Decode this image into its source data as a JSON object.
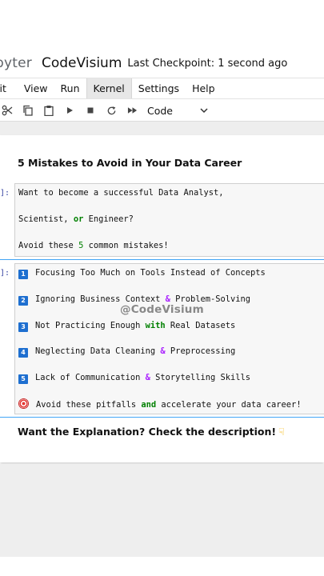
{
  "header": {
    "logo_text": "pyter",
    "notebook_name": "CodeVisium",
    "checkpoint": "Last Checkpoint: 1 second ago"
  },
  "menu": {
    "items": [
      "lit",
      "View",
      "Run",
      "Kernel",
      "Settings",
      "Help"
    ],
    "active": "Kernel"
  },
  "toolbar": {
    "icons": [
      "cut-icon",
      "copy-icon",
      "paste-icon",
      "run-icon",
      "stop-icon",
      "restart-icon",
      "fast-forward-icon"
    ],
    "cell_type": "Code"
  },
  "cells": {
    "heading": "5 Mistakes to Avoid in Your Data Career",
    "cell1": {
      "prompt": "]:",
      "line1": "Want to become a successful Data Analyst,",
      "line2_a": "Scientist, ",
      "line2_or": "or",
      "line2_b": " Engineer?",
      "line3_a": "Avoid these ",
      "line3_num": "5",
      "line3_b": " common mistakes!"
    },
    "cell2": {
      "prompt": "]:",
      "items": [
        {
          "badge": "1",
          "parts": [
            "Focusing Too Much on Tools Instead of Concepts"
          ]
        },
        {
          "badge": "2",
          "a": "Ignoring Business Context ",
          "op": "&",
          "b": " Problem-Solving"
        },
        {
          "badge": "3",
          "a": "Not Practicing Enough ",
          "kw": "with",
          "b": " Real Datasets"
        },
        {
          "badge": "4",
          "a": "Neglecting Data Cleaning ",
          "op": "&",
          "b": " Preprocessing"
        },
        {
          "badge": "5",
          "a": "Lack of Communication ",
          "op": "&",
          "b": " Storytelling Skills"
        }
      ],
      "final_a": "Avoid these pitfalls ",
      "final_kw": "and",
      "final_b": " accelerate your data career!"
    },
    "watermark": "@CodeVisium",
    "explanation": "Want the Explanation? Check the description!"
  }
}
